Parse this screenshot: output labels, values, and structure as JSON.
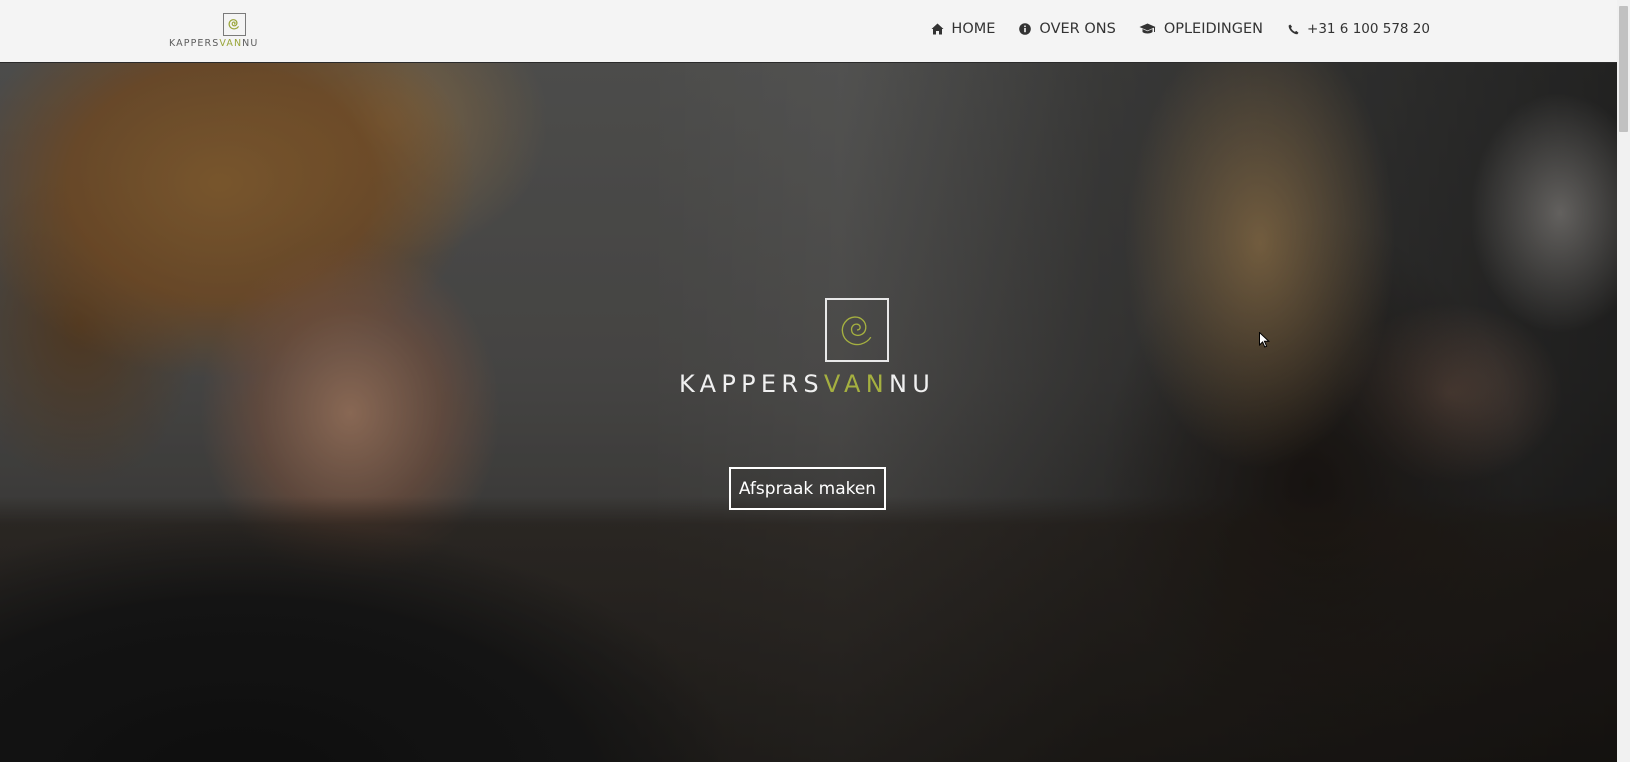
{
  "header": {
    "brand": {
      "text_part1": "KAPPERS",
      "text_accent": "VAN",
      "text_part2": "NU",
      "icon": "spiral-logo-icon"
    },
    "nav": [
      {
        "label": "HOME",
        "icon": "home-icon"
      },
      {
        "label": "OVER ONS",
        "icon": "info-icon"
      },
      {
        "label": "OPLEIDINGEN",
        "icon": "graduation-cap-icon"
      },
      {
        "label": "+31 6 100 578 20",
        "icon": "phone-icon"
      }
    ]
  },
  "hero": {
    "logo": {
      "text_part1": "KAPPERS",
      "text_accent": "VAN",
      "text_part2": "NU",
      "icon": "spiral-logo-icon"
    },
    "cta_label": "Afspraak maken"
  },
  "colors": {
    "accent": "#9aa63a",
    "header_bg": "#f4f4f4",
    "nav_text": "#333333"
  }
}
